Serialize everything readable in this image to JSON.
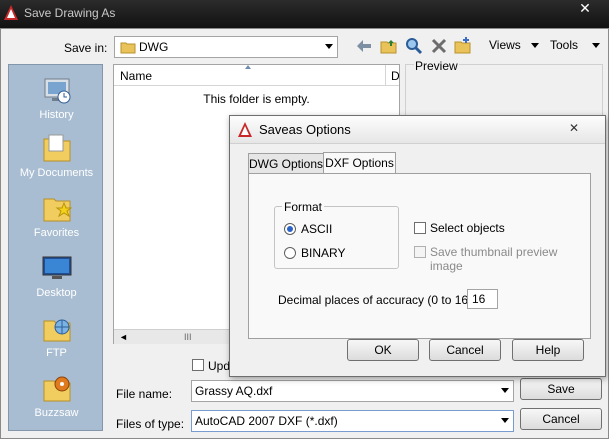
{
  "dialog": {
    "title": "Save Drawing As",
    "close_glyph": "✕",
    "save_in_label": "Save in:",
    "save_in_value": "DWG",
    "toolbar": {
      "views_label": "Views",
      "tools_label": "Tools"
    },
    "places": [
      "History",
      "My Documents",
      "Favorites",
      "Desktop",
      "FTP",
      "Buzzsaw"
    ],
    "list": {
      "column_name": "Name",
      "column_partial": "D",
      "empty_message": "This folder is empty.",
      "scroll_glyph": "III"
    },
    "preview_label": "Preview",
    "update_label": "Upda",
    "file_name_label": "File name:",
    "file_name_value": "Grassy AQ.dxf",
    "files_of_type_label": "Files of type:",
    "files_of_type_value": "AutoCAD 2007 DXF (*.dxf)",
    "save_button": "Save",
    "cancel_button": "Cancel"
  },
  "options_dialog": {
    "title": "Saveas Options",
    "tabs": [
      "DWG Options",
      "DXF Options"
    ],
    "active_tab": "DXF Options",
    "format_group_label": "Format",
    "format_options": [
      "ASCII",
      "BINARY"
    ],
    "format_selected": "ASCII",
    "select_objects_label": "Select objects",
    "thumbnail_label": "Save thumbnail preview image",
    "decimal_label": "Decimal places of accuracy (0 to 16)",
    "decimal_value": "16",
    "ok_button": "OK",
    "cancel_button": "Cancel",
    "help_button": "Help"
  }
}
